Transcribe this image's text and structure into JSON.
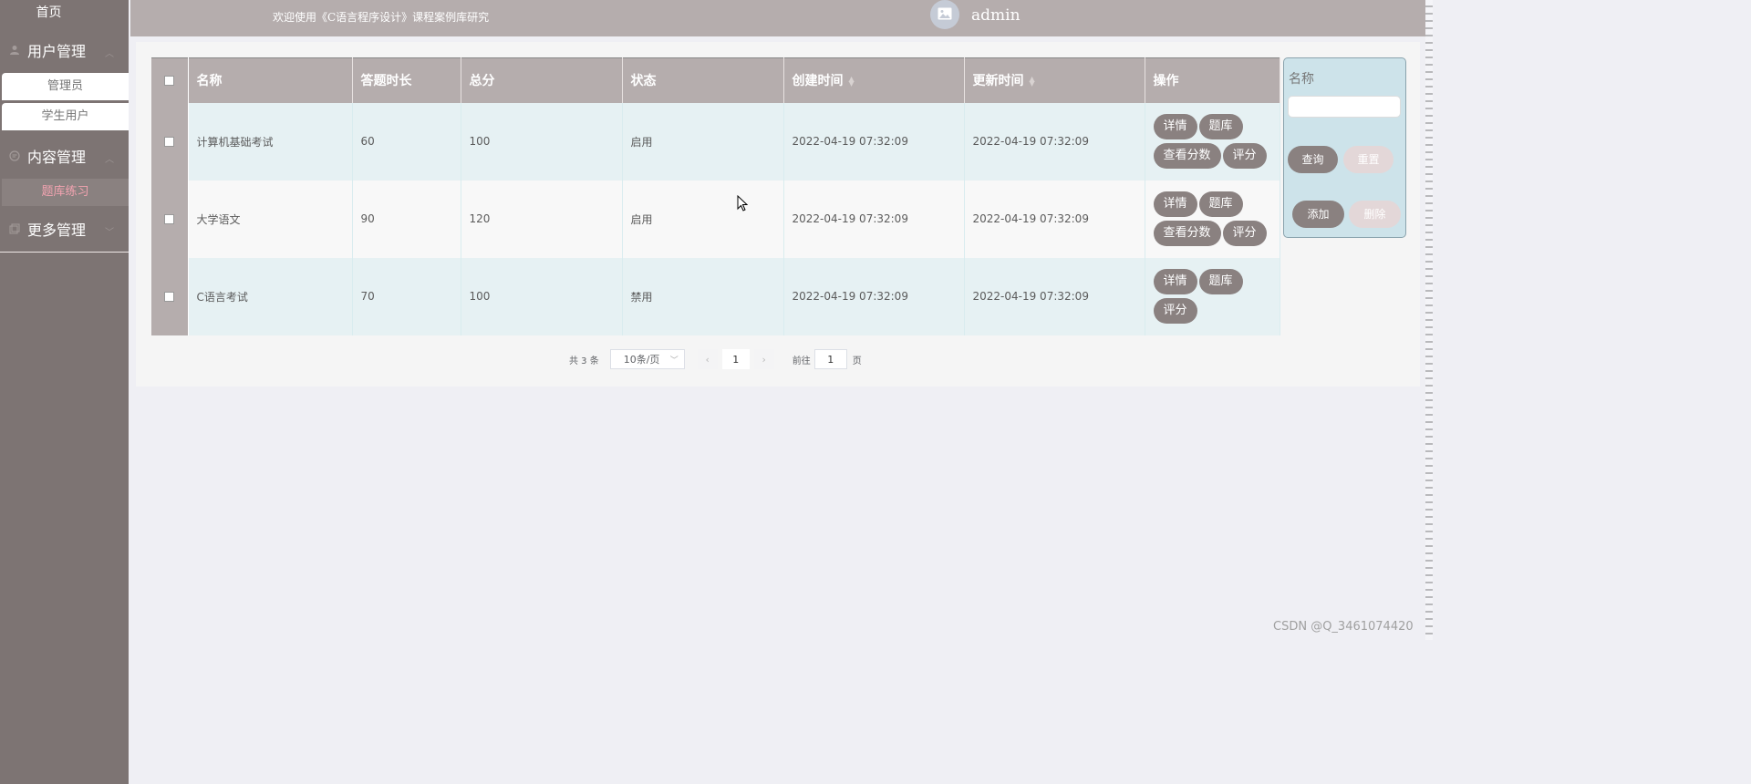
{
  "sidebar": {
    "home": "首页",
    "groups": [
      {
        "label": "用户管理",
        "icon": "user-icon",
        "items": [
          "管理员",
          "学生用户"
        ]
      },
      {
        "label": "内容管理",
        "icon": "chat-icon",
        "items": [
          "题库练习"
        ]
      },
      {
        "label": "更多管理",
        "icon": "copy-icon",
        "items": []
      }
    ],
    "active_item": "题库练习"
  },
  "header": {
    "title": "欢迎使用《C语言程序设计》课程案例库研究",
    "username": "admin"
  },
  "table": {
    "columns": [
      "名称",
      "答题时长",
      "总分",
      "状态",
      "创建时间",
      "更新时间",
      "操作"
    ],
    "rows": [
      {
        "name": "计算机基础考试",
        "duration": "60",
        "score": "100",
        "status": "启用",
        "created": "2022-04-19 07:32:09",
        "updated": "2022-04-19 07:32:09",
        "actions": [
          "详情",
          "题库",
          "查看分数",
          "评分"
        ]
      },
      {
        "name": "大学语文",
        "duration": "90",
        "score": "120",
        "status": "启用",
        "created": "2022-04-19 07:32:09",
        "updated": "2022-04-19 07:32:09",
        "actions": [
          "详情",
          "题库",
          "查看分数",
          "评分"
        ]
      },
      {
        "name": "C语言考试",
        "duration": "70",
        "score": "100",
        "status": "禁用",
        "created": "2022-04-19 07:32:09",
        "updated": "2022-04-19 07:32:09",
        "actions": [
          "详情",
          "题库",
          "评分"
        ]
      }
    ]
  },
  "pagination": {
    "total": "共 3 条",
    "page_size": "10条/页",
    "current": "1",
    "goto_label": "前往",
    "goto_value": "1",
    "page_suffix": "页"
  },
  "search": {
    "label": "名称",
    "query": "查询",
    "reset": "重置",
    "add": "添加",
    "delete": "删除"
  },
  "watermark": "CSDN @Q_3461074420",
  "colors": {
    "sidebar": "#7d7473",
    "header": "#b5adad",
    "button": "#8a8180",
    "active_text": "#f2a3b0",
    "search_panel": "#cde3ea"
  }
}
